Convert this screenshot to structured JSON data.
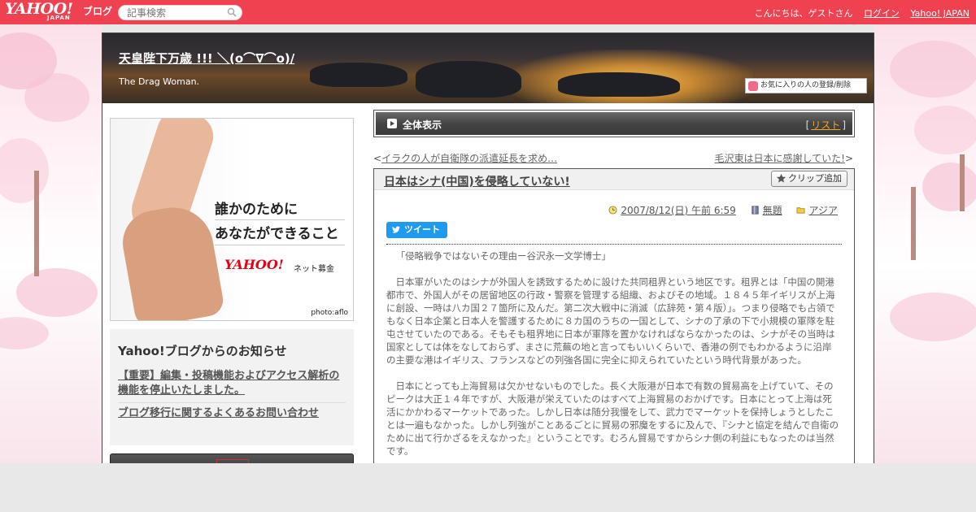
{
  "topbar": {
    "logo": "YAHOO!",
    "logo_sub": "JAPAN",
    "logo_blog": "ブログ",
    "search_placeholder": "記事検索",
    "greeting": "こんにちは、ゲストさん",
    "login": "ログイン",
    "yahoo_japan": "Yahoo! JAPAN"
  },
  "header": {
    "title": "天皇陛下万歳 !!! ＼(o⌒∇⌒o)/",
    "subtitle": "The Drag Woman.",
    "fav_button": "お気に入りの人の登録/削除"
  },
  "ad": {
    "line1": "誰かのために",
    "line2": "あなたができること",
    "logo": "YAHOO!",
    "logo_sub": "ネット募金",
    "photo_credit": "photo:aflo"
  },
  "notice": {
    "title": "Yahoo!ブログからのお知らせ",
    "links": [
      "【重要】編集・投稿機能およびアクセス解析の機能を停止いたしました。",
      "ブログ移行に関するよくあるお問い合わせ"
    ]
  },
  "category_bar": {
    "label": "全体表示",
    "list_open": "[",
    "list_link": "リスト",
    "list_close": "]"
  },
  "nav": {
    "prev_arrow": "<",
    "prev_link": "イラクの人が自衛隊の派遣延長を求め…",
    "next_link": "毛沢東は日本に感謝していた!",
    "next_arrow": ">"
  },
  "article": {
    "title": "日本はシナ(中国)を侵略していない!",
    "clip_button": "クリップ追加",
    "date": "2007/8/12(日) 午前 6:59",
    "book": "無題",
    "folder": "アジア",
    "tweet": "ツイート",
    "paragraphs": [
      "「侵略戦争ではないその理由ー谷沢永一文学博士」",
      "日本軍がいたのはシナが外国人を誘致するために設けた共同租界という地区です。租界とは「中国の開港都市で、外国人がその居留地区の行政・警察を管理する組織、およびその地域。１８４５年イギリスが上海に創設、一時は八カ国２７箇所に及んだ。第二次大戦中に消滅（広辞苑・第４版）」。つまり侵略でも占領でもなく日本企業と日本人を警護するために８カ国のうちの一国として、シナの了承の下で小規模の軍隊を駐屯させていたのである。そもそも租界地に日本が軍隊を置かなければならなかったのは、シナがその当時は国家としては体をなしておらず、まさに荒蕪の地と言ってもいいくらいで、香港の例でもわかるように沿岸の主要な港はイギリス、フランスなどの列強各国に完全に抑えられていたという時代背景があった。",
      "日本にとっても上海貿易は欠かせないものでした。長く大阪港が日本で有数の貿易高を上げていて、そのピークは大正１４年ですが、大阪港が栄えていたのはすべて上海貿易のおかげです。日本にとって上海は死活にかかわるマーケットであった。しかし日本は随分我慢をして、武力でマーケットを保持しょうとしたことは一遍もなかった。しかし列強がことあるごとに貿易の邪魔をするに及んで、『シナと協定を結んで自衛のために出て行かざるをえなかった』ということです。むろん貿易ですからシナ側の利益にもなったのは当然です。"
    ]
  }
}
